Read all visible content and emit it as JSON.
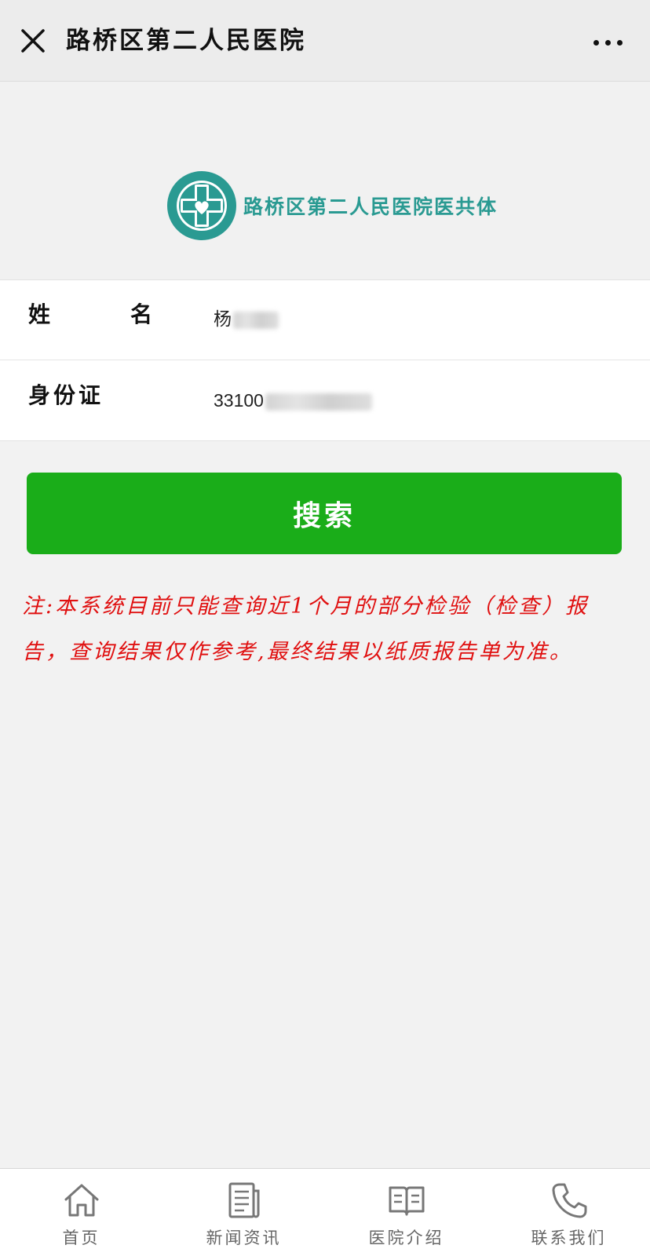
{
  "header": {
    "title": "路桥区第二人民医院",
    "close_icon": "close-icon",
    "more_icon": "more-dots-icon"
  },
  "banner": {
    "logo_icon": "hospital-emblem-icon",
    "logo_text": "路桥区第二人民医院医共体"
  },
  "form": {
    "name_label_1": "姓",
    "name_label_2": "名",
    "name_value": "杨",
    "id_label": "身份证",
    "id_value": "33100"
  },
  "search_button": {
    "label": "搜索"
  },
  "notice": {
    "text": "注:本系统目前只能查询近1个月的部分检验（检查）报告，查询结果仅作参考,最终结果以纸质报告单为准。"
  },
  "tabbar": {
    "items": [
      {
        "label": "首页",
        "icon": "home-icon"
      },
      {
        "label": "新闻资讯",
        "icon": "news-icon"
      },
      {
        "label": "医院介绍",
        "icon": "book-icon"
      },
      {
        "label": "联系我们",
        "icon": "phone-icon"
      }
    ]
  },
  "colors": {
    "accent": "#1aad19",
    "logo_teal": "#2a9a92",
    "notice_red": "#e01010"
  }
}
